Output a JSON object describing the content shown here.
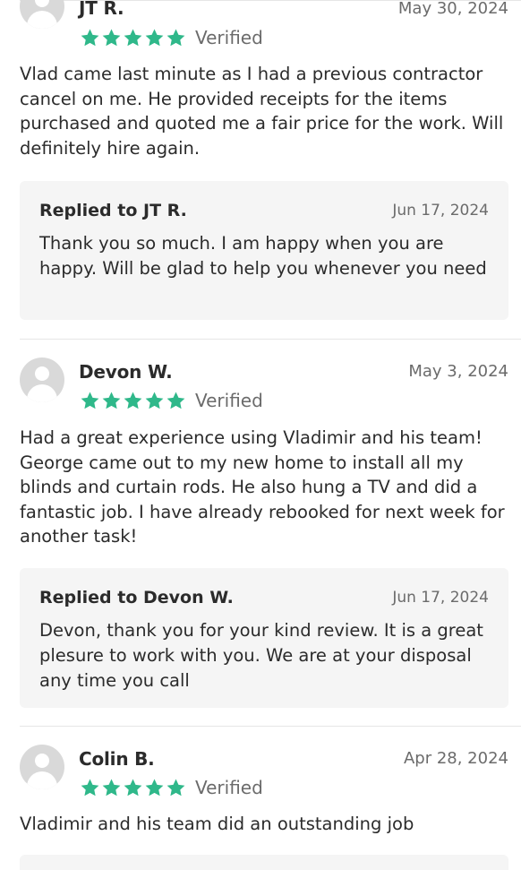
{
  "reviews": [
    {
      "name": "JT R.",
      "date": "May 30, 2024",
      "stars": 5,
      "verified_label": "Verified",
      "text": "Vlad came last minute as I had a previous contractor cancel on me. He provided receipts for the items purchased and quoted me a fair price for the work. Will definitely hire again.",
      "reply": {
        "title": "Replied to JT R.",
        "date": "Jun 17, 2024",
        "text": "Thank you so much. I am happy when you are happy. Will be glad to help you whenever you need"
      }
    },
    {
      "name": "Devon W.",
      "date": "May 3, 2024",
      "stars": 5,
      "verified_label": "Verified",
      "text": "Had a great experience using Vladimir and his team! George came out to my new home to install all my blinds and curtain rods. He also hung a TV and did a fantastic job. I have already rebooked for next week for another task!",
      "reply": {
        "title": "Replied to Devon W.",
        "date": "Jun 17, 2024",
        "text": "Devon, thank you for your kind review. It is a great plesure to work with you. We are at your disposal any time you call"
      }
    },
    {
      "name": "Colin B.",
      "date": "Apr 28, 2024",
      "stars": 5,
      "verified_label": "Verified",
      "text": "Vladimir and his team did an outstanding job"
    }
  ],
  "colors": {
    "star": "#2fb88a",
    "reply_background": "#f5f5f5",
    "divider": "#e6e6e6"
  },
  "icons": {
    "avatar": "user-avatar-placeholder-icon",
    "star": "star-icon"
  }
}
